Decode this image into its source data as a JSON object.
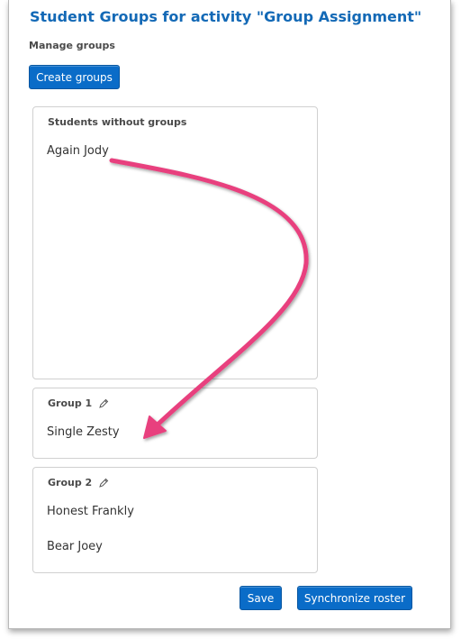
{
  "page": {
    "title": "Student Groups for activity \"Group Assignment\"",
    "subtitle": "Manage groups",
    "create_label": "Create groups"
  },
  "unassigned": {
    "header": "Students without groups",
    "students": [
      "Again Jody"
    ]
  },
  "groups": [
    {
      "name": "Group 1",
      "edit_icon": "pencil-icon",
      "students": [
        "Single Zesty"
      ]
    },
    {
      "name": "Group 2",
      "edit_icon": "pencil-icon",
      "students": [
        "Honest Frankly",
        "Bear Joey"
      ]
    }
  ],
  "footer": {
    "save_label": "Save",
    "sync_label": "Synchronize roster"
  },
  "colors": {
    "accent": "#0a6cc8",
    "title": "#1369b6",
    "annotation_arrow": "#e8417e"
  }
}
